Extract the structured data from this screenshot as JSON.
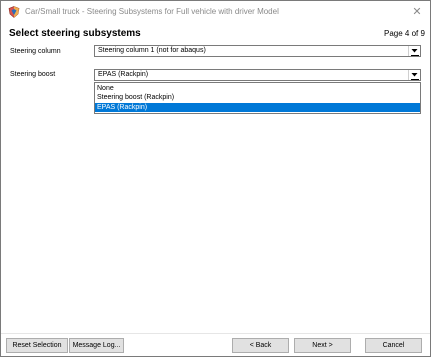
{
  "window": {
    "title": "Car/Small truck - Steering Subsystems for Full vehicle with driver Model",
    "close_icon": "close-icon",
    "app_icon": "shield-icon",
    "colors": {
      "selection": "#0078d7",
      "title_text": "#8a8a8a"
    }
  },
  "header": {
    "heading": "Select steering subsystems",
    "page": "Page  4 of 9"
  },
  "fields": {
    "steering_column": {
      "label": "Steering column",
      "value": "Steering column 1  (not for abaqus)"
    },
    "steering_boost": {
      "label": "Steering boost",
      "value": "EPAS (Rackpin)",
      "options": [
        "None",
        "Steering boost (Rackpin)",
        "EPAS (Rackpin)"
      ],
      "selected_index": 2
    }
  },
  "buttons": {
    "reset": "Reset Selection",
    "message_log": "Message Log...",
    "back": "< Back",
    "next": "Next >",
    "cancel": "Cancel"
  }
}
